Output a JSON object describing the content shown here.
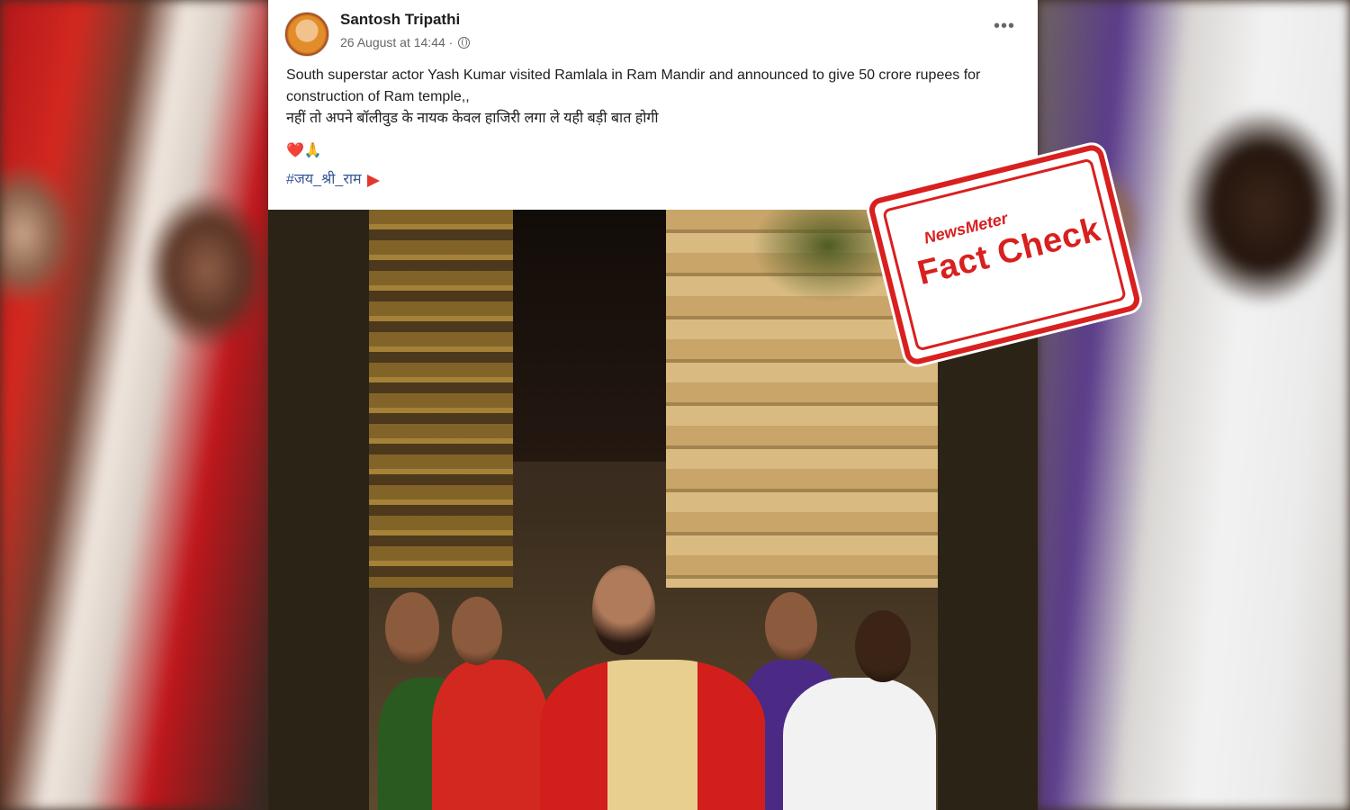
{
  "post": {
    "author": "Santosh Tripathi",
    "timestamp": "26 August at 14:44 ·",
    "privacy_icon": "globe-icon",
    "more_icon": "more-options-icon",
    "text_en": "South superstar actor Yash Kumar visited Ramlala in Ram Mandir and announced to give 50 crore rupees for construction of Ram temple,,",
    "text_hi": "नहीं तो अपने बॉलीवुड के नायक केवल हाजिरी लगा ले यही बड़ी बात होगी",
    "emojis": "❤️🙏",
    "hashtag": "#जय_श्री_राम"
  },
  "stamp": {
    "brand": "NewsMeter",
    "title": "Fact Check"
  },
  "colors": {
    "stamp_red": "#d8201f",
    "link_blue": "#385898",
    "text_dark": "#1c1e21",
    "meta_gray": "#65676b"
  }
}
